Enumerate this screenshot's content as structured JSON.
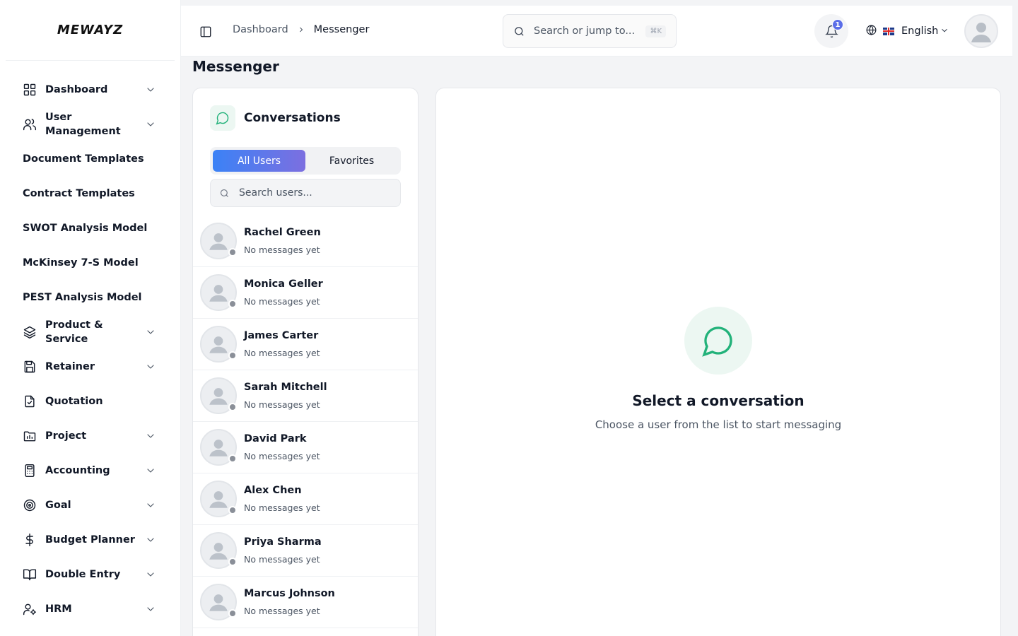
{
  "brand": {
    "logo_text": "MEWAYZ"
  },
  "sidebar": {
    "items": [
      {
        "label": "Dashboard",
        "icon": "grid-icon",
        "has_chevron": true
      },
      {
        "label": "User Management",
        "icon": "users-icon",
        "has_chevron": true
      },
      {
        "label": "Document Templates",
        "icon": "",
        "has_chevron": false
      },
      {
        "label": "Contract Templates",
        "icon": "",
        "has_chevron": false
      },
      {
        "label": "SWOT Analysis Model",
        "icon": "",
        "has_chevron": false
      },
      {
        "label": "McKinsey 7-S Model",
        "icon": "",
        "has_chevron": false
      },
      {
        "label": "PEST Analysis Model",
        "icon": "",
        "has_chevron": false
      },
      {
        "label": "Product & Service",
        "icon": "layers-icon",
        "has_chevron": true
      },
      {
        "label": "Retainer",
        "icon": "save-icon",
        "has_chevron": true
      },
      {
        "label": "Quotation",
        "icon": "file-check-icon",
        "has_chevron": false
      },
      {
        "label": "Project",
        "icon": "folder-chart-icon",
        "has_chevron": true
      },
      {
        "label": "Accounting",
        "icon": "calculator-icon",
        "has_chevron": true
      },
      {
        "label": "Goal",
        "icon": "target-icon",
        "has_chevron": true
      },
      {
        "label": "Budget Planner",
        "icon": "dollar-icon",
        "has_chevron": true
      },
      {
        "label": "Double Entry",
        "icon": "book-icon",
        "has_chevron": true
      },
      {
        "label": "HRM",
        "icon": "user-cog-icon",
        "has_chevron": true
      }
    ]
  },
  "header": {
    "breadcrumb": [
      "Dashboard",
      "Messenger"
    ],
    "search_placeholder": "Search or jump to...",
    "search_shortcut": "⌘K",
    "notification_count": "1",
    "language": "English"
  },
  "page": {
    "title": "Messenger"
  },
  "conversations": {
    "title": "Conversations",
    "tabs": [
      {
        "label": "All Users",
        "active": true
      },
      {
        "label": "Favorites",
        "active": false
      }
    ],
    "search_placeholder": "Search users...",
    "users": [
      {
        "name": "Rachel Green",
        "last_message": "No messages yet"
      },
      {
        "name": "Monica Geller",
        "last_message": "No messages yet"
      },
      {
        "name": "James Carter",
        "last_message": "No messages yet"
      },
      {
        "name": "Sarah Mitchell",
        "last_message": "No messages yet"
      },
      {
        "name": "David Park",
        "last_message": "No messages yet"
      },
      {
        "name": "Alex Chen",
        "last_message": "No messages yet"
      },
      {
        "name": "Priya Sharma",
        "last_message": "No messages yet"
      },
      {
        "name": "Marcus Johnson",
        "last_message": "No messages yet"
      }
    ]
  },
  "chat": {
    "empty_title": "Select a conversation",
    "empty_subtitle": "Choose a user from the list to start messaging"
  },
  "colors": {
    "accent_gradient_start": "#3b82f6",
    "accent_gradient_end": "#7c6fe0",
    "chat_green": "#22b27a",
    "badge": "#5b6ee8",
    "status_offline": "#8a8f98"
  }
}
